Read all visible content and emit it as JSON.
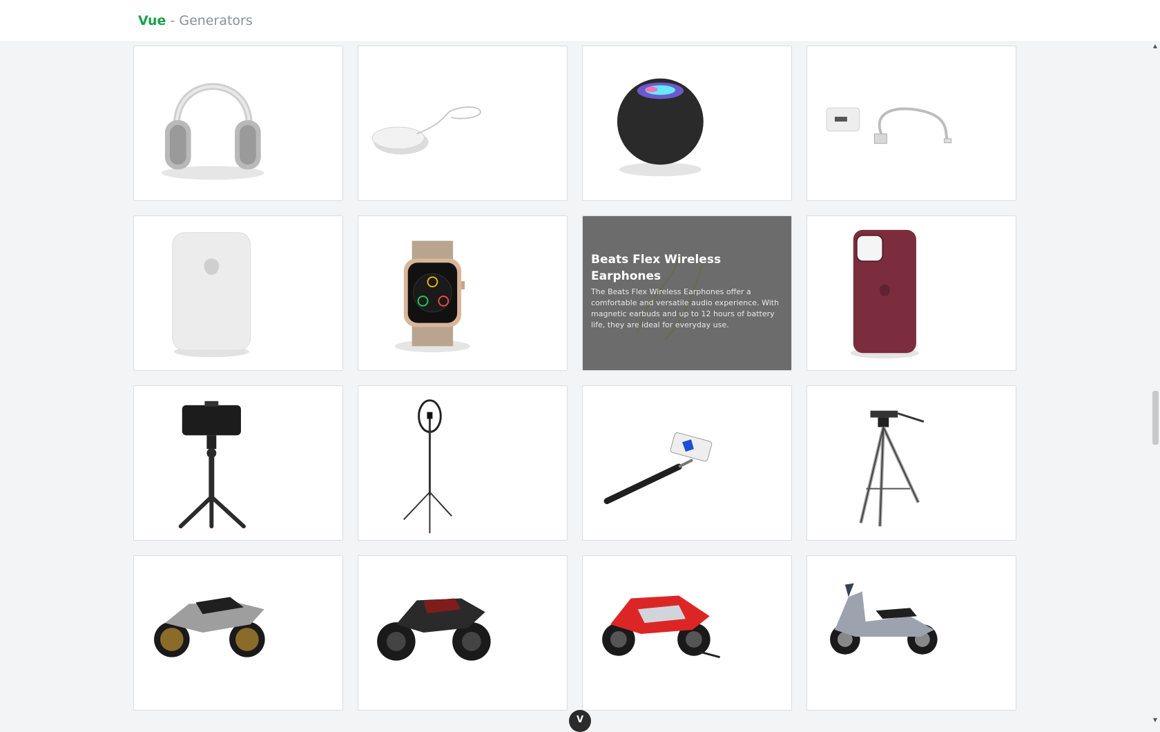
{
  "header": {
    "brand_primary": "Vue",
    "brand_secondary": " - Generators"
  },
  "products": [
    {
      "icon": "headphones-icon"
    },
    {
      "icon": "wireless-charger-icon"
    },
    {
      "icon": "smart-speaker-icon"
    },
    {
      "icon": "usb-charger-cable-icon"
    },
    {
      "icon": "battery-pack-icon"
    },
    {
      "icon": "smartwatch-icon"
    },
    {
      "icon": "earphones-icon",
      "title": "Beats Flex Wireless Earphones",
      "description": "The Beats Flex Wireless Earphones offer a comfortable and versatile audio experience. With magnetic earbuds and up to 12 hours of battery life, they are ideal for everyday use."
    },
    {
      "icon": "phone-case-icon"
    },
    {
      "icon": "phone-tripod-icon"
    },
    {
      "icon": "ring-light-icon"
    },
    {
      "icon": "selfie-stick-icon"
    },
    {
      "icon": "camera-tripod-icon"
    },
    {
      "icon": "sport-motorcycle-icon"
    },
    {
      "icon": "naked-motorcycle-icon"
    },
    {
      "icon": "racing-motorcycle-icon"
    },
    {
      "icon": "scooter-icon"
    }
  ],
  "colors": {
    "brand": "#16a34a",
    "page_background": "#f3f4f6",
    "overlay": "#5f5f5f"
  },
  "scroll_button": {
    "glyph": "V"
  }
}
